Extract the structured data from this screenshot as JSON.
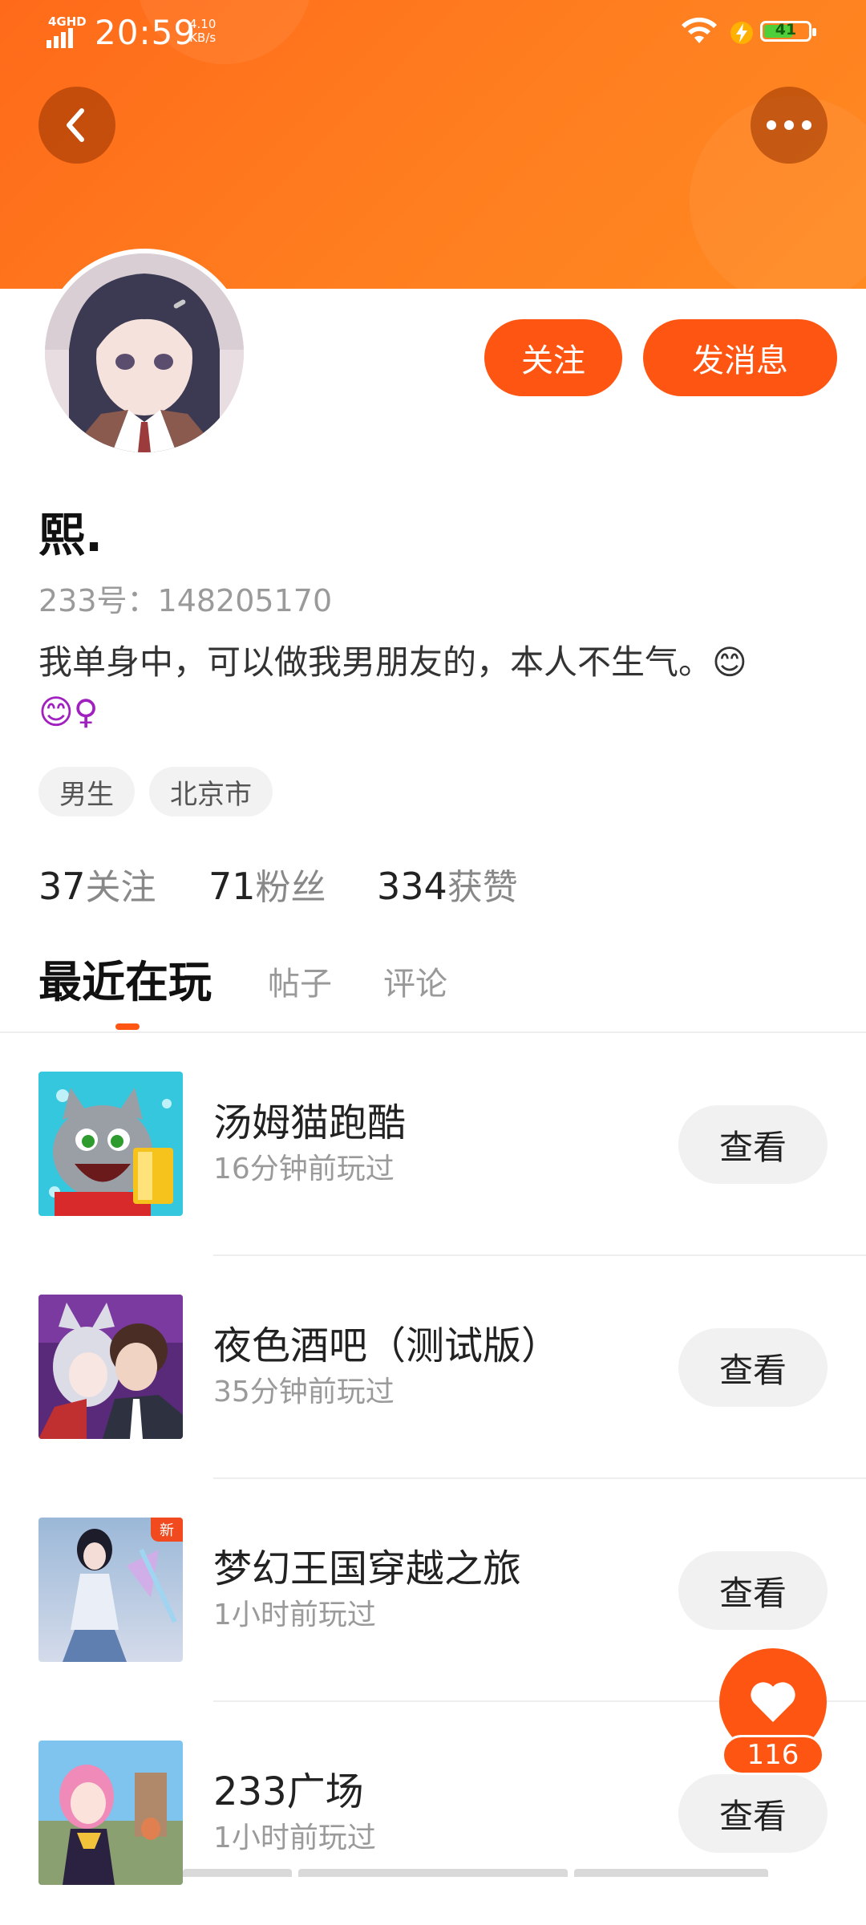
{
  "status_bar": {
    "network": "4GHD",
    "time": "20:59",
    "speed_value": "4.10",
    "speed_unit": "KB/s",
    "battery": "41"
  },
  "header": {
    "back_icon": "chevron-left-icon",
    "more_icon": "more-horizontal-icon",
    "gradient_color": "#ff7a1d"
  },
  "profile": {
    "follow_label": "关注",
    "message_label": "发消息",
    "name": "熙.",
    "uid": "233号：148205170",
    "bio_line1": "我单身中，可以做我男朋友的，本人不生气。😊",
    "bio_line2": "😊♀",
    "tags": [
      "男生",
      "北京市"
    ],
    "stats": [
      {
        "value": "37",
        "label": "关注"
      },
      {
        "value": "71",
        "label": "粉丝"
      },
      {
        "value": "334",
        "label": "获赞"
      }
    ]
  },
  "tabs": {
    "items": [
      "最近在玩",
      "帖子",
      "评论"
    ],
    "active": "最近在玩"
  },
  "games": [
    {
      "title": "汤姆猫跑酷",
      "time": "16分钟前玩过",
      "button": "查看"
    },
    {
      "title": "夜色酒吧（测试版）",
      "time": "35分钟前玩过",
      "button": "查看"
    },
    {
      "title": "梦幻王国穿越之旅",
      "time": "1小时前玩过",
      "button": "查看",
      "badge": "新"
    },
    {
      "title": "233广场",
      "time": "1小时前玩过",
      "button": "查看"
    }
  ],
  "like": {
    "icon": "heart-icon",
    "count": "116"
  },
  "colors": {
    "accent": "#ff5512",
    "header": "#ff7a1d"
  }
}
